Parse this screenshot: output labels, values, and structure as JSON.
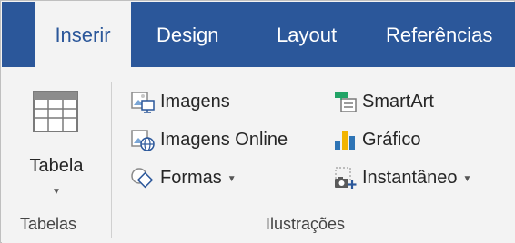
{
  "tabs": [
    {
      "label": "Inserir",
      "active": true
    },
    {
      "label": "Design",
      "active": false
    },
    {
      "label": "Layout",
      "active": false
    },
    {
      "label": "Referências",
      "active": false
    }
  ],
  "groups": {
    "tabelas": {
      "label": "Tabelas",
      "button": {
        "label": "Tabela",
        "icon": "table-icon",
        "has_dropdown": true
      }
    },
    "ilustracoes": {
      "label": "Ilustrações",
      "buttons": [
        {
          "label": "Imagens",
          "icon": "pictures-icon"
        },
        {
          "label": "Imagens Online",
          "icon": "online-pictures-icon"
        },
        {
          "label": "Formas",
          "icon": "shapes-icon",
          "has_dropdown": true
        },
        {
          "label": "SmartArt",
          "icon": "smartart-icon"
        },
        {
          "label": "Gráfico",
          "icon": "chart-icon"
        },
        {
          "label": "Instantâneo",
          "icon": "screenshot-icon",
          "has_dropdown": true
        }
      ]
    }
  },
  "colors": {
    "accent": "#2b579a",
    "ribbon_bg": "#f3f3f3",
    "chart_blue": "#2e74b5",
    "chart_gold": "#f2b400",
    "smartart_green": "#21a366"
  }
}
